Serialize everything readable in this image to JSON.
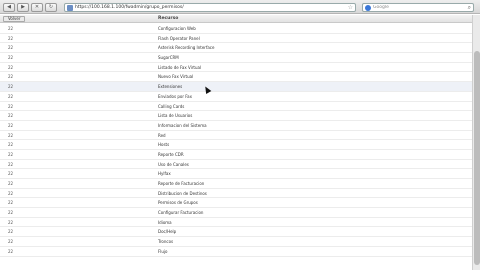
{
  "toolbar": {
    "back_icon": "back-arrow-icon",
    "forward_icon": "forward-arrow-icon",
    "url": "https://100.168.1.100/fwadmin/grupo_permisos/",
    "search_placeholder": "Google"
  },
  "table": {
    "back_button_label": "Volver",
    "header_recurso": "Recurso",
    "rows": [
      {
        "id": "22",
        "recurso": "Configuracion Web"
      },
      {
        "id": "22",
        "recurso": "Flash Operator Panel"
      },
      {
        "id": "22",
        "recurso": "Asterisk Recording Interface"
      },
      {
        "id": "22",
        "recurso": "SugarCRM"
      },
      {
        "id": "22",
        "recurso": "Listado de Fax Virtual"
      },
      {
        "id": "22",
        "recurso": "Nuevo Fax Virtual"
      },
      {
        "id": "22",
        "recurso": "Extensiones"
      },
      {
        "id": "22",
        "recurso": "Enviados por Fax"
      },
      {
        "id": "22",
        "recurso": "Calling Cards"
      },
      {
        "id": "22",
        "recurso": "Lista de Usuarios"
      },
      {
        "id": "22",
        "recurso": "Informacion del Sistema"
      },
      {
        "id": "22",
        "recurso": "Red"
      },
      {
        "id": "22",
        "recurso": "Hosts"
      },
      {
        "id": "22",
        "recurso": "Reporte CDR"
      },
      {
        "id": "22",
        "recurso": "Uso de Canales"
      },
      {
        "id": "22",
        "recurso": "Hylfax"
      },
      {
        "id": "22",
        "recurso": "Reporte de Facturacion"
      },
      {
        "id": "22",
        "recurso": "Distribucion de Destinos"
      },
      {
        "id": "22",
        "recurso": "Permisos de Grupos"
      },
      {
        "id": "22",
        "recurso": "Configurar Facturacion"
      },
      {
        "id": "22",
        "recurso": "Idioma"
      },
      {
        "id": "22",
        "recurso": "Doc/Help"
      },
      {
        "id": "22",
        "recurso": "Troncos"
      },
      {
        "id": "22",
        "recurso": "Flujo"
      }
    ]
  },
  "highlighted_row_index": 6
}
